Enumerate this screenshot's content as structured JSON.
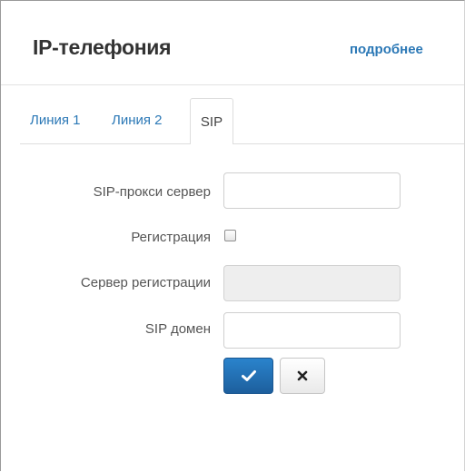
{
  "header": {
    "title": "IP-телефония",
    "more_link": "подробнее"
  },
  "tabs": [
    {
      "label": "Линия 1",
      "active": false
    },
    {
      "label": "Линия 2",
      "active": false
    },
    {
      "label": "SIP",
      "active": true
    }
  ],
  "form": {
    "sip_proxy": {
      "label": "SIP-прокси сервер",
      "value": ""
    },
    "registration": {
      "label": "Регистрация",
      "checked": false
    },
    "registration_server": {
      "label": "Сервер регистрации",
      "value": "",
      "disabled": true
    },
    "sip_domain": {
      "label": "SIP домен",
      "value": ""
    }
  },
  "buttons": {
    "apply_icon": "check-icon",
    "cancel_icon": "close-icon"
  },
  "colors": {
    "link": "#2b78b6",
    "primary_button": "#1f6db3",
    "disabled_field": "#eeeeee"
  }
}
